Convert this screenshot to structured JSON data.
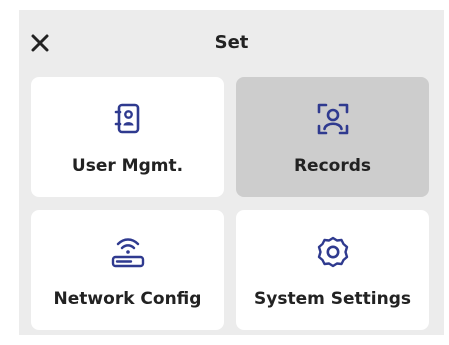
{
  "dialog": {
    "title": "Set",
    "close_icon": "close-icon"
  },
  "colors": {
    "icon_blue": "#2f3a8f",
    "text": "#222222",
    "tile": "#ffffff",
    "tile_selected": "#cdcdcd",
    "panel": "#ececec"
  },
  "tiles": [
    {
      "label": "User Mgmt.",
      "icon": "contact-book-icon",
      "selected": false
    },
    {
      "label": "Records",
      "icon": "face-scan-icon",
      "selected": true
    },
    {
      "label": "Network Config",
      "icon": "router-wifi-icon",
      "selected": false
    },
    {
      "label": "System Settings",
      "icon": "gear-icon",
      "selected": false
    }
  ]
}
